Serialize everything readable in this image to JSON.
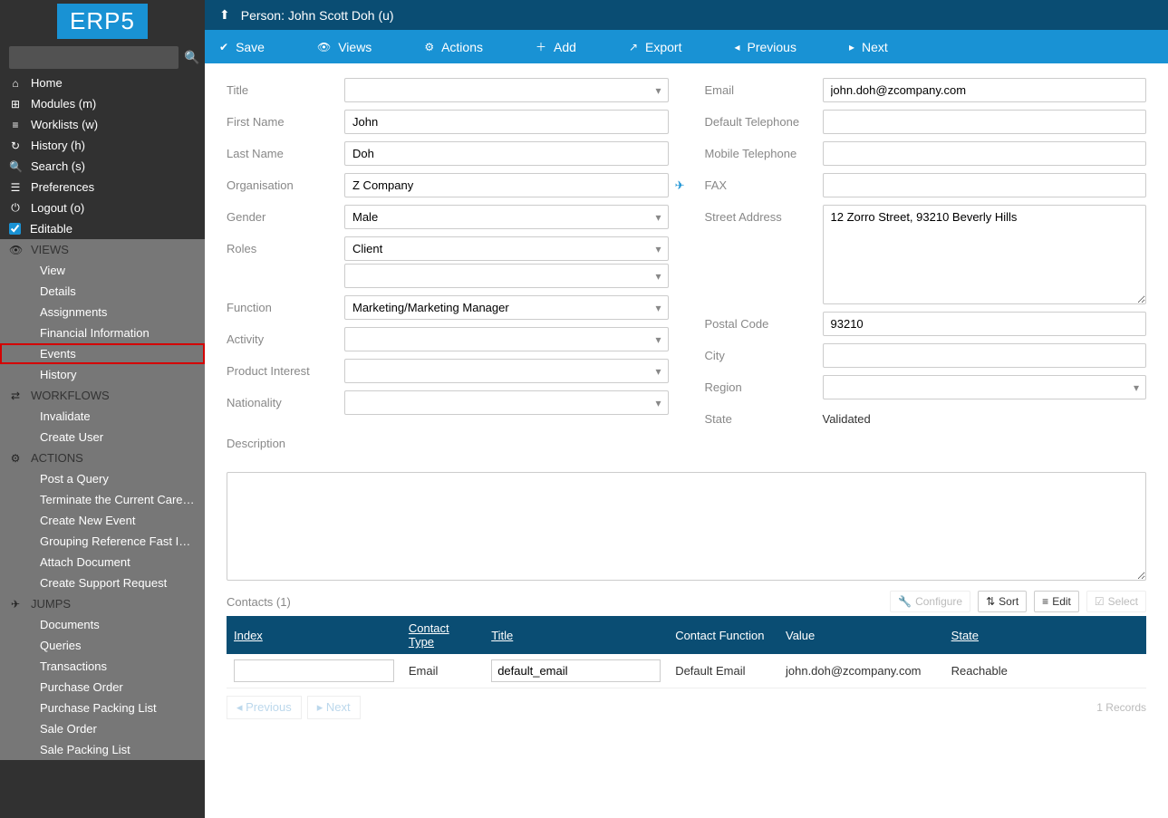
{
  "logo": "ERP5",
  "sidebar": {
    "search_placeholder": "",
    "nav": [
      {
        "icon": "home",
        "label": "Home"
      },
      {
        "icon": "puzzle",
        "label": "Modules (m)"
      },
      {
        "icon": "list",
        "label": "Worklists (w)"
      },
      {
        "icon": "history",
        "label": "History (h)"
      },
      {
        "icon": "search",
        "label": "Search (s)"
      },
      {
        "icon": "sliders",
        "label": "Preferences"
      },
      {
        "icon": "power",
        "label": "Logout (o)"
      },
      {
        "icon": "check",
        "label": "Editable"
      }
    ],
    "sections": [
      {
        "icon": "eye",
        "title": "VIEWS",
        "items": [
          "View",
          "Details",
          "Assignments",
          "Financial Information",
          "Events",
          "History"
        ],
        "highlighted": 4
      },
      {
        "icon": "random",
        "title": "WORKFLOWS",
        "items": [
          "Invalidate",
          "Create User"
        ]
      },
      {
        "icon": "cogs",
        "title": "ACTIONS",
        "items": [
          "Post a Query",
          "Terminate the Current Career…",
          "Create New Event",
          "Grouping Reference Fast Input",
          "Attach Document",
          "Create Support Request"
        ]
      },
      {
        "icon": "plane",
        "title": "JUMPS",
        "items": [
          "Documents",
          "Queries",
          "Transactions",
          "Purchase Order",
          "Purchase Packing List",
          "Sale Order",
          "Sale Packing List"
        ]
      }
    ]
  },
  "breadcrumb": "Person: John Scott Doh (u)",
  "toolbar": [
    {
      "icon": "check",
      "label": "Save"
    },
    {
      "icon": "eye",
      "label": "Views"
    },
    {
      "icon": "cogs",
      "label": "Actions"
    },
    {
      "icon": "plus",
      "label": "Add"
    },
    {
      "icon": "share",
      "label": "Export"
    },
    {
      "icon": "caret-left",
      "label": "Previous"
    },
    {
      "icon": "caret-right",
      "label": "Next"
    }
  ],
  "form": {
    "left": {
      "title_label": "Title",
      "title_value": "",
      "first_name_label": "First Name",
      "first_name_value": "John",
      "last_name_label": "Last Name",
      "last_name_value": "Doh",
      "organisation_label": "Organisation",
      "organisation_value": "Z Company",
      "gender_label": "Gender",
      "gender_value": "Male",
      "roles_label": "Roles",
      "roles_value": "Client",
      "roles_value2": "",
      "function_label": "Function",
      "function_value": "Marketing/Marketing Manager",
      "activity_label": "Activity",
      "activity_value": "",
      "product_interest_label": "Product Interest",
      "product_interest_value": "",
      "nationality_label": "Nationality",
      "nationality_value": "",
      "description_label": "Description",
      "description_value": ""
    },
    "right": {
      "email_label": "Email",
      "email_value": "john.doh@zcompany.com",
      "def_tel_label": "Default Telephone",
      "def_tel_value": "",
      "mob_tel_label": "Mobile Telephone",
      "mob_tel_value": "",
      "fax_label": "FAX",
      "fax_value": "",
      "street_label": "Street Address",
      "street_value": "12 Zorro Street, 93210 Beverly Hills",
      "postal_label": "Postal Code",
      "postal_value": "93210",
      "city_label": "City",
      "city_value": "",
      "region_label": "Region",
      "region_value": "",
      "state_label": "State",
      "state_value": "Validated"
    }
  },
  "contacts": {
    "title": "Contacts (1)",
    "actions": {
      "configure": "Configure",
      "sort": "Sort",
      "edit": "Edit",
      "select": "Select"
    },
    "headers": {
      "index": "Index",
      "contact_type": "Contact Type",
      "title": "Title",
      "contact_function": "Contact Function",
      "value": "Value",
      "state": "State"
    },
    "rows": [
      {
        "index": "",
        "contact_type": "Email",
        "title": "default_email",
        "contact_function": "Default Email",
        "value": "john.doh@zcompany.com",
        "state": "Reachable"
      }
    ],
    "pager": {
      "prev": "Previous",
      "next": "Next",
      "records": "1 Records"
    }
  }
}
